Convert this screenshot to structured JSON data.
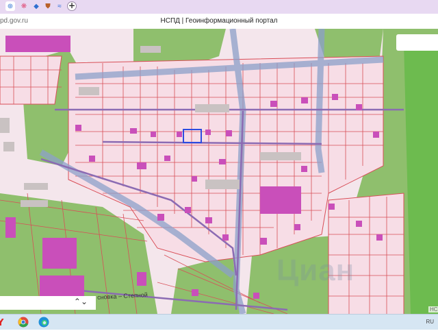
{
  "browser": {
    "tabs": [
      {
        "name": "tab-nspd",
        "icon": "globe-icon",
        "active": true
      },
      {
        "name": "tab-app-2",
        "icon": "multicolor-app-icon"
      },
      {
        "name": "tab-app-3",
        "icon": "drop-icon"
      },
      {
        "name": "tab-app-4",
        "icon": "shield-icon"
      },
      {
        "name": "tab-app-5",
        "icon": "wave-icon"
      }
    ],
    "new_tab_label": "+",
    "url": "pd.gov.ru",
    "page_title": "НСПД | Геоинформационный портал"
  },
  "map": {
    "street_label": "сновка – Степной",
    "watermark": "Циан",
    "corner_label": "НСП",
    "colors": {
      "parcel_fill": "#f7dde6",
      "parcel_border": "#d84e57",
      "building": "#c94fba",
      "green": "#8fbf6d",
      "road": "#8ca0c9",
      "selection": "#2c4be0"
    }
  },
  "search_select": {
    "value": "",
    "chevron": "chevron-down-icon"
  },
  "taskbar": {
    "apps": [
      "yandex-browser-icon",
      "chrome-icon",
      "edge-icon"
    ],
    "lang": "RU"
  }
}
